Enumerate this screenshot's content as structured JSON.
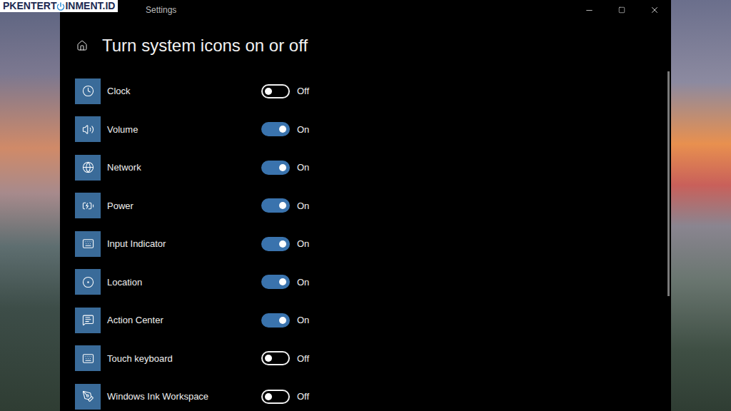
{
  "watermark": {
    "before": "PKENTERT",
    "after": "INMENT.ID"
  },
  "window": {
    "title": "Settings"
  },
  "page": {
    "title": "Turn system icons on or off"
  },
  "items": [
    {
      "label": "Clock",
      "on": false,
      "state": "Off"
    },
    {
      "label": "Volume",
      "on": true,
      "state": "On"
    },
    {
      "label": "Network",
      "on": true,
      "state": "On"
    },
    {
      "label": "Power",
      "on": true,
      "state": "On"
    },
    {
      "label": "Input Indicator",
      "on": true,
      "state": "On"
    },
    {
      "label": "Location",
      "on": true,
      "state": "On"
    },
    {
      "label": "Action Center",
      "on": true,
      "state": "On"
    },
    {
      "label": "Touch keyboard",
      "on": false,
      "state": "Off"
    },
    {
      "label": "Windows Ink Workspace",
      "on": false,
      "state": "Off"
    }
  ]
}
